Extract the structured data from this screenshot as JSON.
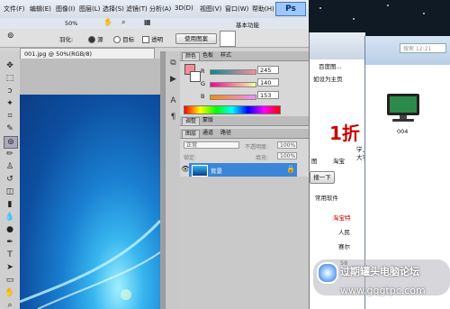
{
  "photoshop": {
    "badge": "Ps",
    "menus": [
      "文件(F)",
      "编辑(E)",
      "图像(I)",
      "图层(L)",
      "选择(S)",
      "滤镜(T)",
      "分析(A)",
      "3D(D)",
      "视图(V)",
      "窗口(W)",
      "帮助(H)"
    ],
    "zoom": "50%",
    "workspace": "基本功能",
    "options": {
      "feather_label": "羽化:",
      "feather_value": "0 px",
      "source_label": "源",
      "target_label": "目标",
      "transparent_label": "透明",
      "use_pattern_button": "使用图案"
    },
    "document_tab": "001.jpg @ 50%(RGB/8)",
    "color_panel": {
      "tabs": [
        "颜色",
        "色板",
        "样式"
      ],
      "r_label": "R",
      "g_label": "G",
      "b_label": "B",
      "r": "245",
      "g": "140",
      "b": "153",
      "foreground_color": "#f58c99"
    },
    "adjust_panel": {
      "tabs": [
        "调整",
        "蒙版"
      ]
    },
    "layers_panel": {
      "tabs": [
        "图层",
        "通道",
        "路径"
      ],
      "blend_mode": "正常",
      "opacity_label": "不透明度:",
      "opacity": "100%",
      "lock_label": "锁定:",
      "fill_label": "填充:",
      "fill": "100%",
      "layer_name": "背景"
    }
  },
  "browser": {
    "tab_text": "百度图...",
    "nav_text": "如设为主页",
    "banner_text": "1折",
    "tab_labels": [
      "图",
      "淘宝"
    ],
    "side_texts": [
      "学上",
      "大学"
    ],
    "button_text": "搜一下",
    "link_text": "常用软件",
    "red_item": "淘宝特",
    "items": [
      "人民",
      "赛尔"
    ],
    "number_text": "58"
  },
  "explorer": {
    "search_placeholder": "搜索 12:21",
    "file_name": "004"
  },
  "watermark": {
    "title": "过期罐头电脑论坛",
    "url": "www.gqgtpc.com"
  },
  "colors": {
    "accent_blue": "#3b86d9",
    "desktop_bg": "#0f1a24"
  }
}
